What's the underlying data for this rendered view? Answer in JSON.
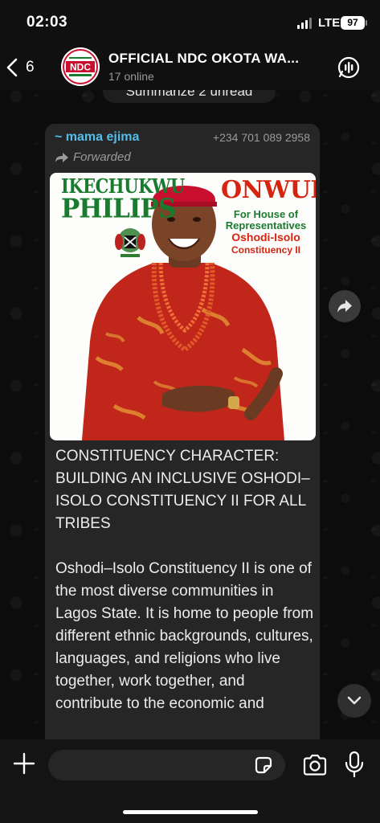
{
  "status_bar": {
    "time": "02:03",
    "network": "LTE",
    "battery": "97"
  },
  "header": {
    "back_count": "6",
    "title": "OFFICIAL  NDC  OKOTA WA...",
    "subtitle": "17 online",
    "avatar_text": "NDC"
  },
  "summarize_pill": "Summarize 2 unread",
  "message": {
    "sender": "~ mama ejima",
    "sender_phone": "+234 701 089 2958",
    "forwarded_label": "Forwarded",
    "poster": {
      "name_line1": "IKECHUKWU",
      "name_line2": "PHILIPS",
      "surname": "ONWUKA",
      "line1": "For House of",
      "line2": "Representatives",
      "line3": "Oshodi-Isolo",
      "line4": "Constituency II"
    },
    "text_heading": "CONSTITUENCY CHARACTER: BUILDING AN INCLUSIVE OSHODI–ISOLO CONSTITUENCY II FOR ALL TRIBES",
    "text_body": "Oshodi–Isolo Constituency II is one of the most diverse communities in Lagos State. It is home to people from different ethnic backgrounds, cultures, languages, and religions who live together, work together, and contribute to the economic and"
  },
  "icons": {
    "back": "chevron-left-icon",
    "header_action": "ai-summary-icon",
    "forward": "forward-arrow-icon",
    "scroll_down": "chevron-down-icon",
    "plus": "plus-icon",
    "sticker": "sticker-icon",
    "camera": "camera-icon",
    "mic": "microphone-icon"
  },
  "colors": {
    "sender_name": "#53bdeb",
    "bubble_bg": "#262626",
    "poster_green": "#1a7a2e",
    "poster_red": "#d62410"
  }
}
